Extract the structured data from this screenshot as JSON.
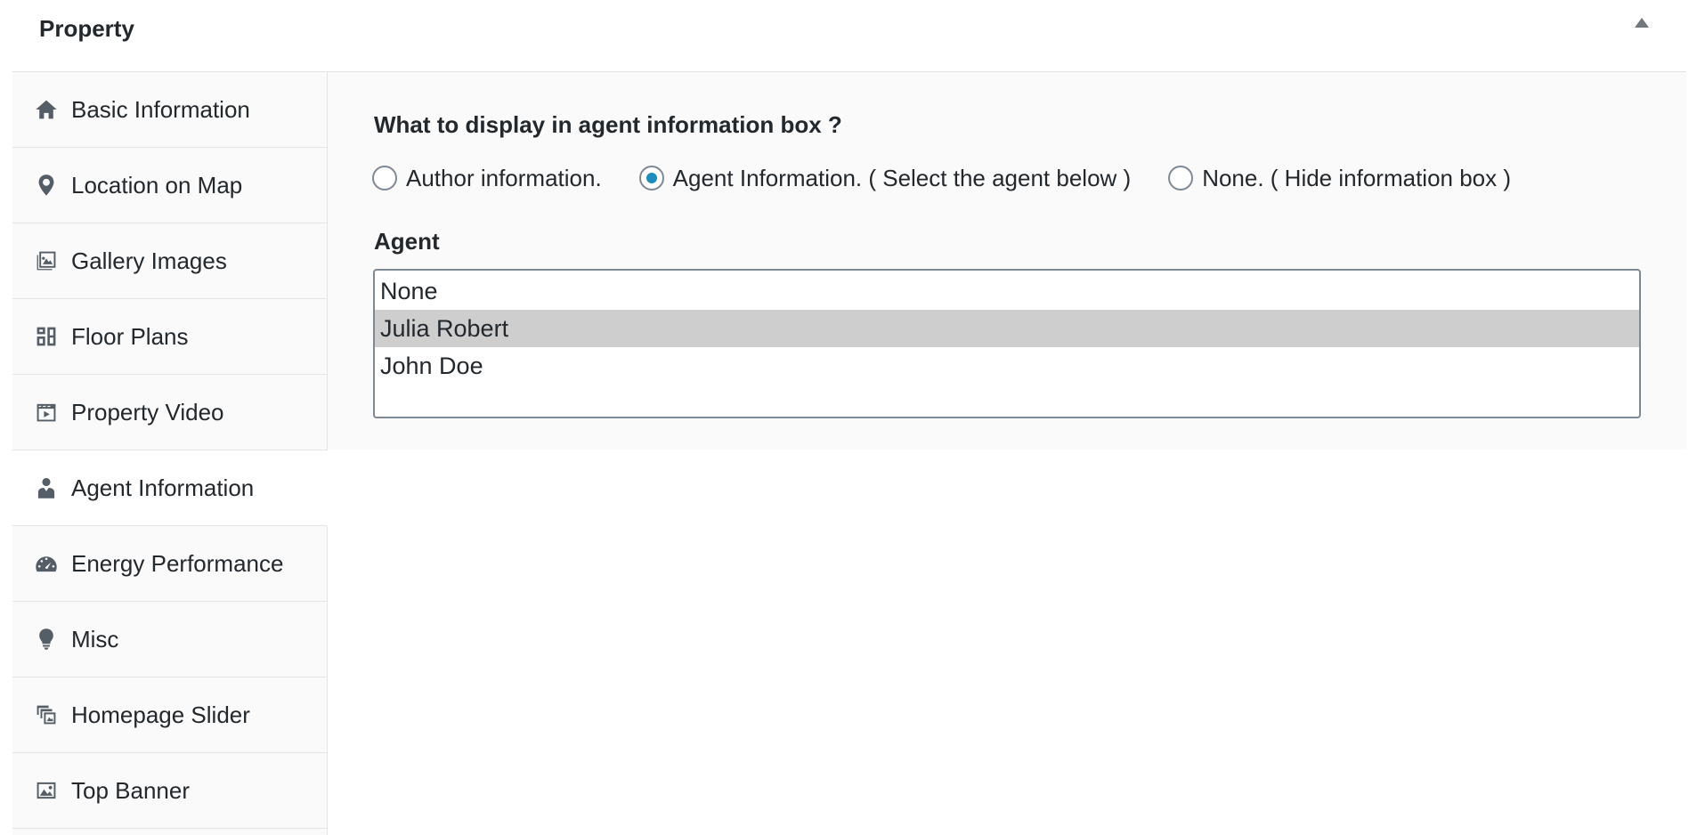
{
  "header": {
    "title": "Property"
  },
  "sidebar": {
    "items": [
      {
        "label": "Basic Information",
        "icon": "home-icon"
      },
      {
        "label": "Location on Map",
        "icon": "location-pin-icon"
      },
      {
        "label": "Gallery Images",
        "icon": "gallery-icon"
      },
      {
        "label": "Floor Plans",
        "icon": "floor-plans-icon"
      },
      {
        "label": "Property Video",
        "icon": "video-icon"
      },
      {
        "label": "Agent Information",
        "icon": "person-icon",
        "active": true
      },
      {
        "label": "Energy Performance",
        "icon": "dashboard-icon"
      },
      {
        "label": "Misc",
        "icon": "lightbulb-icon"
      },
      {
        "label": "Homepage Slider",
        "icon": "slides-icon"
      },
      {
        "label": "Top Banner",
        "icon": "image-icon"
      }
    ]
  },
  "main": {
    "question": "What to display in agent information box ?",
    "options": [
      {
        "label": "Author information.",
        "checked": false
      },
      {
        "label": "Agent Information. ( Select the agent below )",
        "checked": true
      },
      {
        "label": "None. ( Hide information box )",
        "checked": false
      }
    ],
    "agent_label": "Agent",
    "agents": [
      {
        "label": "None",
        "selected": false
      },
      {
        "label": "Julia Robert",
        "selected": true
      },
      {
        "label": "John Doe",
        "selected": false
      }
    ]
  },
  "colors": {
    "accent": "#1e8cbe",
    "selected_row": "#cecece",
    "panel_bg": "#fafafa"
  }
}
